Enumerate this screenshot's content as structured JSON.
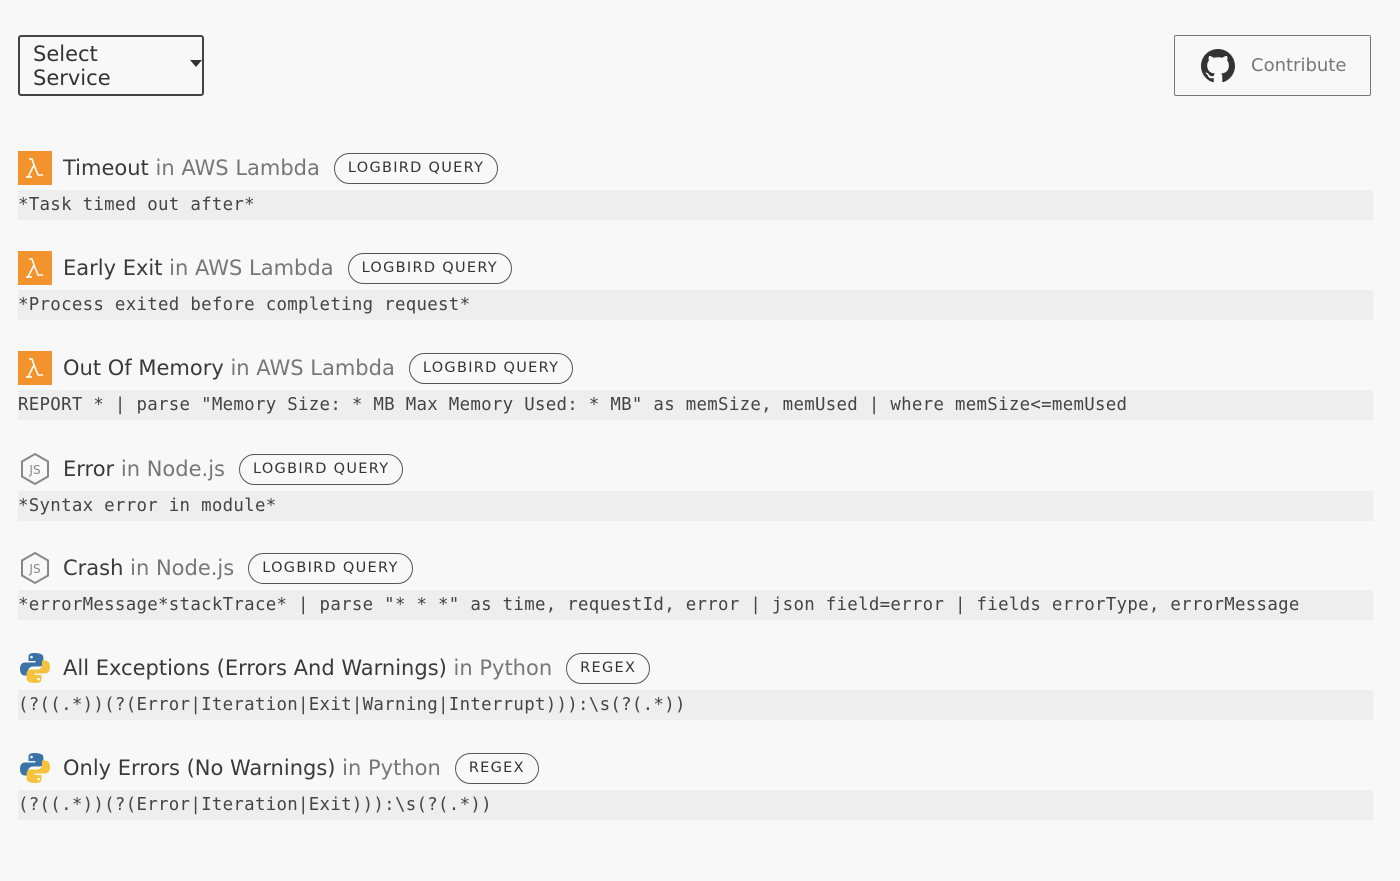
{
  "header": {
    "select_label": "Select Service",
    "contribute_label": "Contribute"
  },
  "icons": {
    "lambda": "aws-lambda-icon",
    "nodejs": "nodejs-icon",
    "python": "python-icon",
    "github": "github-icon"
  },
  "colors": {
    "lambda_orange": "#f2932d",
    "python_blue": "#3b73a8",
    "python_yellow": "#f4c33b"
  },
  "entries": [
    {
      "icon": "lambda",
      "name": "Timeout",
      "in": "in",
      "service": "AWS Lambda",
      "badge": "LOGBIRD QUERY",
      "code": "*Task timed out after*"
    },
    {
      "icon": "lambda",
      "name": "Early Exit",
      "in": "in",
      "service": "AWS Lambda",
      "badge": "LOGBIRD QUERY",
      "code": "*Process exited before completing request*"
    },
    {
      "icon": "lambda",
      "name": "Out Of Memory",
      "in": "in",
      "service": "AWS Lambda",
      "badge": "LOGBIRD QUERY",
      "code": "REPORT * | parse \"Memory Size: * MB Max Memory Used: * MB\" as memSize, memUsed | where memSize<=memUsed"
    },
    {
      "icon": "nodejs",
      "name": "Error",
      "in": "in",
      "service": "Node.js",
      "badge": "LOGBIRD QUERY",
      "code": "*Syntax error in module*"
    },
    {
      "icon": "nodejs",
      "name": "Crash",
      "in": "in",
      "service": "Node.js",
      "badge": "LOGBIRD QUERY",
      "code": "*errorMessage*stackTrace* | parse \"* * *\" as time, requestId, error | json field=error | fields errorType, errorMessage"
    },
    {
      "icon": "python",
      "name": "All Exceptions (Errors And Warnings)",
      "in": "in",
      "service": "Python",
      "badge": "REGEX",
      "code": "(?((.*))(?(Error|Iteration|Exit|Warning|Interrupt))):\\s(?(.*))"
    },
    {
      "icon": "python",
      "name": "Only Errors (No Warnings)",
      "in": "in",
      "service": "Python",
      "badge": "REGEX",
      "code": "(?((.*))(?(Error|Iteration|Exit))):\\s(?(.*))"
    }
  ]
}
